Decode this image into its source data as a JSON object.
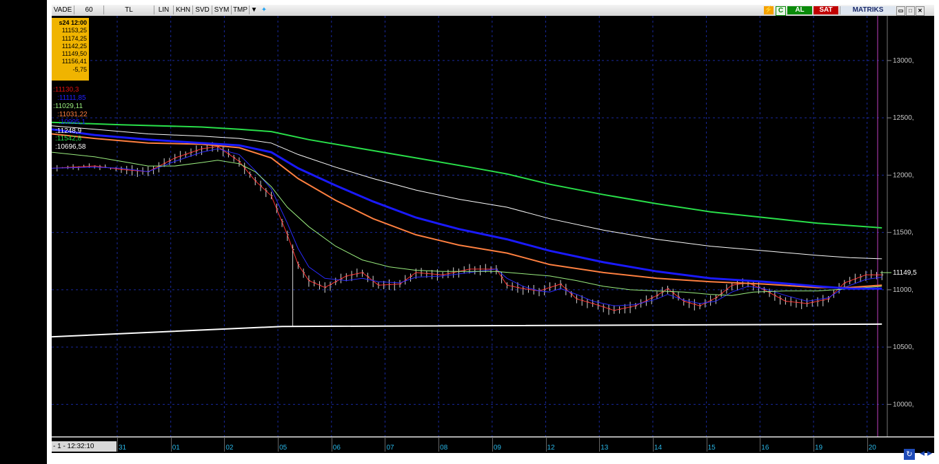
{
  "toolbar": {
    "items": [
      "VADE",
      "60",
      "TL",
      "LIN",
      "KHN",
      "SVD",
      "SYM",
      "TMP"
    ],
    "buy_label": "AL",
    "sell_label": "SAT",
    "brand": "MATRIKS",
    "refresh_label": "C"
  },
  "info_box": [
    "s24 12:00",
    "11153,25",
    "11174,25",
    "11142,25",
    "11149,50",
    "11156,41",
    "-5,75"
  ],
  "legend": [
    {
      "text": ":11130,3",
      "color": "#e01010"
    },
    {
      "text": ":11111,85",
      "color": "#2020ff"
    },
    {
      "text": ":11029,11",
      "color": "#9cf080"
    },
    {
      "text": ":11031,22",
      "color": "#ff8040"
    },
    {
      "text": ":10995,1",
      "color": "#1a1aff"
    },
    {
      "text": ":11248,9",
      "color": "#ffffff"
    },
    {
      "text": ":11542,8",
      "color": "#29e04a"
    },
    {
      "text": ":10696,58",
      "color": "#ffffff"
    }
  ],
  "datetime_label": "- 1 - 12:32:10",
  "chart_data": {
    "type": "line",
    "y_ticks": [
      "13000,",
      "12500,",
      "12000,",
      "11500,",
      "11000,",
      "10500,",
      "10000,"
    ],
    "y_tick_values": [
      13000,
      12500,
      12000,
      11500,
      11000,
      10500,
      10000
    ],
    "ylim": [
      9720,
      13390
    ],
    "last_price_label": "11149,5",
    "last_price": 11149.5,
    "x_ticks": [
      "31",
      "01",
      "02",
      "05",
      "06",
      "07",
      "08",
      "09",
      "12",
      "13",
      "14",
      "15",
      "16",
      "19",
      "20"
    ],
    "x_tick_index": [
      0,
      10,
      20,
      30,
      40,
      50,
      60,
      70,
      80,
      90,
      100,
      110,
      120,
      130,
      140
    ],
    "x_range": [
      -13,
      143
    ],
    "series": [
      {
        "color": "#ff3030",
        "width": 1,
        "points": [
          [
            -13,
            12060
          ],
          [
            -5,
            12080
          ],
          [
            0,
            12050
          ],
          [
            5,
            12030
          ],
          [
            10,
            12150
          ],
          [
            15,
            12230
          ],
          [
            18,
            12250
          ],
          [
            22,
            12120
          ],
          [
            25,
            11950
          ],
          [
            28,
            11820
          ],
          [
            31,
            11480
          ],
          [
            33,
            11220
          ],
          [
            35,
            11080
          ],
          [
            38,
            11020
          ],
          [
            42,
            11120
          ],
          [
            45,
            11150
          ],
          [
            48,
            11040
          ],
          [
            52,
            11050
          ],
          [
            55,
            11150
          ],
          [
            60,
            11130
          ],
          [
            65,
            11180
          ],
          [
            70,
            11180
          ],
          [
            72,
            11040
          ],
          [
            75,
            11010
          ],
          [
            78,
            10990
          ],
          [
            80,
            11020
          ],
          [
            82,
            11050
          ],
          [
            85,
            10920
          ],
          [
            88,
            10880
          ],
          [
            92,
            10820
          ],
          [
            96,
            10860
          ],
          [
            100,
            10950
          ],
          [
            102,
            11010
          ],
          [
            105,
            10900
          ],
          [
            108,
            10860
          ],
          [
            111,
            10930
          ],
          [
            114,
            11040
          ],
          [
            117,
            11060
          ],
          [
            120,
            11000
          ],
          [
            124,
            10900
          ],
          [
            128,
            10880
          ],
          [
            132,
            10920
          ],
          [
            135,
            11060
          ],
          [
            139,
            11130
          ],
          [
            142,
            11130
          ]
        ]
      },
      {
        "color": "#2a2aff",
        "width": 1,
        "points": [
          [
            -13,
            12060
          ],
          [
            -5,
            12070
          ],
          [
            0,
            12060
          ],
          [
            5,
            12030
          ],
          [
            10,
            12120
          ],
          [
            15,
            12200
          ],
          [
            18,
            12230
          ],
          [
            22,
            12180
          ],
          [
            25,
            12040
          ],
          [
            28,
            11880
          ],
          [
            31,
            11580
          ],
          [
            33,
            11360
          ],
          [
            35,
            11200
          ],
          [
            38,
            11100
          ],
          [
            42,
            11080
          ],
          [
            45,
            11100
          ],
          [
            48,
            11070
          ],
          [
            52,
            11060
          ],
          [
            55,
            11110
          ],
          [
            60,
            11120
          ],
          [
            65,
            11150
          ],
          [
            70,
            11180
          ],
          [
            72,
            11100
          ],
          [
            75,
            11030
          ],
          [
            78,
            10990
          ],
          [
            80,
            10980
          ],
          [
            82,
            11010
          ],
          [
            85,
            10960
          ],
          [
            88,
            10900
          ],
          [
            92,
            10860
          ],
          [
            96,
            10870
          ],
          [
            100,
            10920
          ],
          [
            102,
            10960
          ],
          [
            105,
            10910
          ],
          [
            108,
            10880
          ],
          [
            111,
            10900
          ],
          [
            114,
            10980
          ],
          [
            117,
            11030
          ],
          [
            120,
            11010
          ],
          [
            124,
            10950
          ],
          [
            128,
            10900
          ],
          [
            132,
            10930
          ],
          [
            135,
            11020
          ],
          [
            139,
            11090
          ],
          [
            142,
            11110
          ]
        ]
      },
      {
        "color": "#9cf080",
        "width": 1,
        "points": [
          [
            -13,
            12200
          ],
          [
            -5,
            12160
          ],
          [
            0,
            12120
          ],
          [
            5,
            12080
          ],
          [
            10,
            12080
          ],
          [
            15,
            12110
          ],
          [
            18,
            12130
          ],
          [
            22,
            12100
          ],
          [
            25,
            12030
          ],
          [
            28,
            11900
          ],
          [
            31,
            11720
          ],
          [
            35,
            11550
          ],
          [
            40,
            11380
          ],
          [
            45,
            11260
          ],
          [
            50,
            11200
          ],
          [
            55,
            11170
          ],
          [
            60,
            11160
          ],
          [
            65,
            11160
          ],
          [
            70,
            11160
          ],
          [
            75,
            11140
          ],
          [
            80,
            11120
          ],
          [
            85,
            11080
          ],
          [
            90,
            11030
          ],
          [
            95,
            11000
          ],
          [
            100,
            10990
          ],
          [
            105,
            10980
          ],
          [
            110,
            10960
          ],
          [
            114,
            10950
          ],
          [
            118,
            10980
          ],
          [
            124,
            10990
          ],
          [
            130,
            10990
          ],
          [
            136,
            11010
          ],
          [
            142,
            11030
          ]
        ]
      },
      {
        "color": "#ff8040",
        "width": 2,
        "points": [
          [
            -13,
            12360
          ],
          [
            -5,
            12320
          ],
          [
            5,
            12280
          ],
          [
            15,
            12270
          ],
          [
            22,
            12240
          ],
          [
            28,
            12150
          ],
          [
            33,
            11970
          ],
          [
            40,
            11780
          ],
          [
            47,
            11620
          ],
          [
            55,
            11480
          ],
          [
            63,
            11390
          ],
          [
            72,
            11320
          ],
          [
            80,
            11220
          ],
          [
            90,
            11150
          ],
          [
            100,
            11100
          ],
          [
            110,
            11070
          ],
          [
            120,
            11050
          ],
          [
            130,
            11020
          ],
          [
            136,
            11020
          ],
          [
            142,
            11040
          ]
        ]
      },
      {
        "color": "#1a1aff",
        "width": 3,
        "points": [
          [
            -13,
            12400
          ],
          [
            -5,
            12350
          ],
          [
            5,
            12310
          ],
          [
            15,
            12280
          ],
          [
            22,
            12260
          ],
          [
            28,
            12200
          ],
          [
            33,
            12060
          ],
          [
            40,
            11910
          ],
          [
            47,
            11770
          ],
          [
            55,
            11630
          ],
          [
            63,
            11530
          ],
          [
            72,
            11440
          ],
          [
            80,
            11340
          ],
          [
            90,
            11240
          ],
          [
            100,
            11160
          ],
          [
            110,
            11100
          ],
          [
            120,
            11070
          ],
          [
            130,
            11030
          ],
          [
            136,
            11010
          ],
          [
            142,
            11010
          ]
        ]
      },
      {
        "color": "#ffffff",
        "width": 1,
        "points": [
          [
            -13,
            12430
          ],
          [
            -5,
            12400
          ],
          [
            5,
            12360
          ],
          [
            15,
            12340
          ],
          [
            22,
            12320
          ],
          [
            28,
            12280
          ],
          [
            33,
            12180
          ],
          [
            40,
            12070
          ],
          [
            47,
            11970
          ],
          [
            55,
            11870
          ],
          [
            63,
            11790
          ],
          [
            72,
            11720
          ],
          [
            80,
            11620
          ],
          [
            90,
            11520
          ],
          [
            100,
            11440
          ],
          [
            110,
            11380
          ],
          [
            120,
            11340
          ],
          [
            130,
            11300
          ],
          [
            136,
            11280
          ],
          [
            142,
            11270
          ]
        ]
      },
      {
        "color": "#29e04a",
        "width": 2,
        "points": [
          [
            -13,
            12460
          ],
          [
            0,
            12440
          ],
          [
            15,
            12420
          ],
          [
            22,
            12400
          ],
          [
            28,
            12380
          ],
          [
            35,
            12310
          ],
          [
            45,
            12230
          ],
          [
            55,
            12150
          ],
          [
            65,
            12070
          ],
          [
            72,
            12010
          ],
          [
            80,
            11920
          ],
          [
            90,
            11830
          ],
          [
            100,
            11750
          ],
          [
            110,
            11680
          ],
          [
            120,
            11630
          ],
          [
            130,
            11580
          ],
          [
            142,
            11540
          ]
        ]
      },
      {
        "color": "#ffffff",
        "width": 2,
        "points": [
          [
            -13,
            10590
          ],
          [
            30,
            10680
          ],
          [
            142,
            10700
          ]
        ]
      }
    ]
  }
}
